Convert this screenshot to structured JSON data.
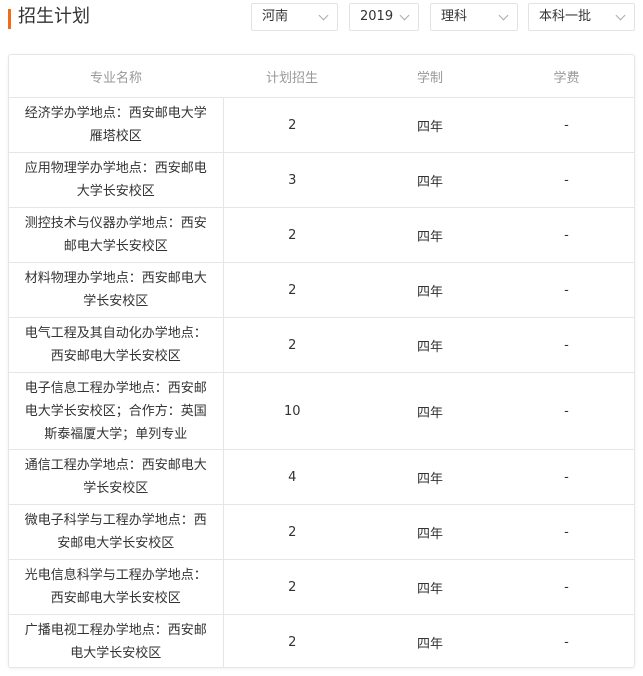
{
  "header": {
    "title": "招生计划",
    "filters": [
      {
        "label": "河南"
      },
      {
        "label": "2019"
      },
      {
        "label": "理科"
      },
      {
        "label": "本科一批"
      }
    ]
  },
  "table": {
    "columns": [
      "专业名称",
      "计划招生",
      "学制",
      "学费"
    ],
    "rows": [
      {
        "name": "经济学办学地点：西安邮电大学雁塔校区",
        "plan": "2",
        "duration": "四年",
        "fee": "-"
      },
      {
        "name": "应用物理学办学地点：西安邮电大学长安校区",
        "plan": "3",
        "duration": "四年",
        "fee": "-"
      },
      {
        "name": "测控技术与仪器办学地点：西安邮电大学长安校区",
        "plan": "2",
        "duration": "四年",
        "fee": "-"
      },
      {
        "name": "材料物理办学地点：西安邮电大学长安校区",
        "plan": "2",
        "duration": "四年",
        "fee": "-"
      },
      {
        "name": "电气工程及其自动化办学地点：西安邮电大学长安校区",
        "plan": "2",
        "duration": "四年",
        "fee": "-"
      },
      {
        "name": "电子信息工程办学地点：西安邮电大学长安校区；合作方：英国斯泰福厦大学；单列专业",
        "plan": "10",
        "duration": "四年",
        "fee": "-"
      },
      {
        "name": "通信工程办学地点：西安邮电大学长安校区",
        "plan": "4",
        "duration": "四年",
        "fee": "-"
      },
      {
        "name": "微电子科学与工程办学地点：西安邮电大学长安校区",
        "plan": "2",
        "duration": "四年",
        "fee": "-"
      },
      {
        "name": "光电信息科学与工程办学地点：西安邮电大学长安校区",
        "plan": "2",
        "duration": "四年",
        "fee": "-"
      },
      {
        "name": "广播电视工程办学地点：西安邮电大学长安校区",
        "plan": "2",
        "duration": "四年",
        "fee": "-"
      }
    ]
  },
  "colors": {
    "accent": "#f26b1d",
    "header_text": "#999999",
    "border": "#e6e6e6"
  }
}
